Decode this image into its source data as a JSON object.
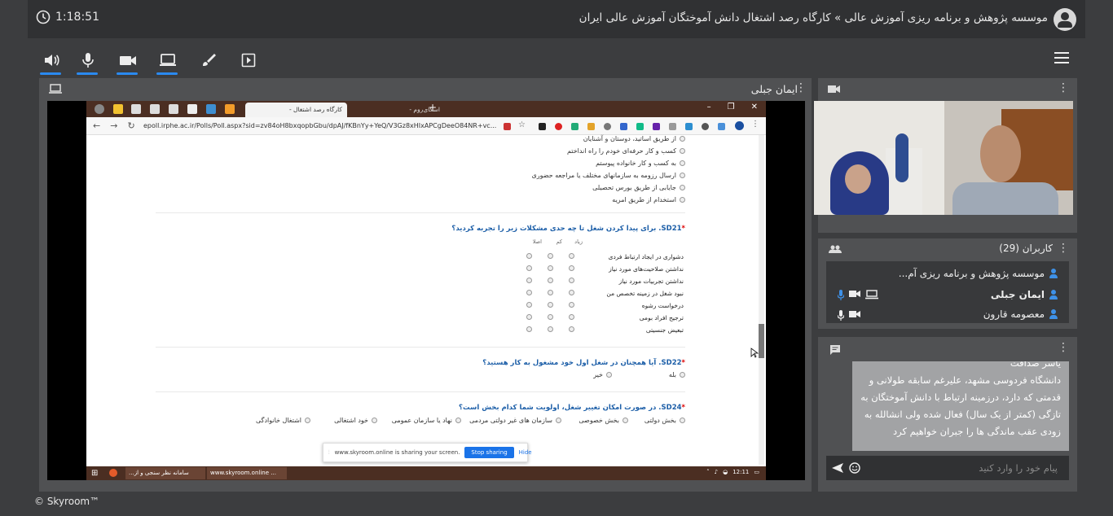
{
  "header": {
    "timer": "1:18:51",
    "breadcrumb": "موسسه پژوهش و برنامه ریزی آموزش عالی » کارگاه رصد اشتغال دانش آموختگان آموزش عالی ایران"
  },
  "share_panel": {
    "title": "ایمان جبلی"
  },
  "browser": {
    "active_tab": "کارگاه رصد اشتغال -",
    "second_tab": "اسکای‌روم - ",
    "url": "epoll.irphe.ac.ir/Polls/Poll.aspx?sid=zv84oH8bxqopbGbu/dpAJ/fKBnYy+YeQ/V3Gz8xHIxAPCgDeeO84NR+vc...",
    "share_notice": "www.skyroom.online is sharing your screen.",
    "stop_sharing": "Stop sharing",
    "hide": "Hide",
    "taskbar_items": [
      "...سامانه نظر سنجی و از",
      "www.skyroom.online ..."
    ],
    "clock": "12:11"
  },
  "survey": {
    "prev_options": [
      "از طریق اساتید، دوستان و آشنایان",
      "کسب و کار حرفه‌ای خودم را راه انداختم",
      "به کسب و کار خانواده پیوستم",
      "ارسال رزومه به سازمانهای مختلف یا مراجعه حضوری",
      "جایابی از طریق بورس تحصیلی",
      "استخدام از طریق امریه"
    ],
    "q21": "SD21. برای پیدا کردن شغل تا چه حدی مشکلات زیر را تجربه کردید؟",
    "matrix_headers": [
      "زیاد",
      "کم",
      "اصلا"
    ],
    "matrix_rows": [
      "دشواری در ایجاد ارتباط فردی",
      "نداشتن صلاحیت‌های مورد نیاز",
      "نداشتن تجربیات مورد نیاز",
      "نبود شغل در زمینه تخصص من",
      "درخواست رشوه",
      "ترجیح افراد بومی",
      "تبعیض جنسیتی"
    ],
    "q22": "SD22. آیا همچنان در شغل اول خود مشغول به کار هستید؟",
    "q22_options": [
      "بله",
      "خیر"
    ],
    "q24": "SD24. در صورت امکان تغییر شغل، اولویت شما کدام بخش است؟",
    "q24_options": [
      "بخش دولتی",
      "بخش خصوصی",
      "سازمان های غیر دولتی مردمی",
      "نهاد یا سازمان عمومی",
      "خود اشتغالی",
      "اشتغال خانوادگی"
    ]
  },
  "users_panel": {
    "title": "کاربران (29)",
    "users": [
      "موسسه پژوهش و برنامه ریزی آم...",
      "ایمان جبلی",
      "معصومه قارون"
    ]
  },
  "chat": {
    "sender": "یاسر صداقت",
    "message": "دانشگاه فردوسی مشهد، علیرغم سابقه طولانی و قدمتی که دارد، درزمینه ارتباط با دانش آموختگان به تازگی (کمتر از یک سال) فعال شده ولی انشالله به زودی عقب ماندگی ها را جبران خواهیم کرد",
    "placeholder": "پیام خود را وارد کنید"
  },
  "footer": "© Skyroom™",
  "colors": {
    "accent": "#2a8af0",
    "panel": "#505153",
    "background": "#3c3d3f"
  }
}
